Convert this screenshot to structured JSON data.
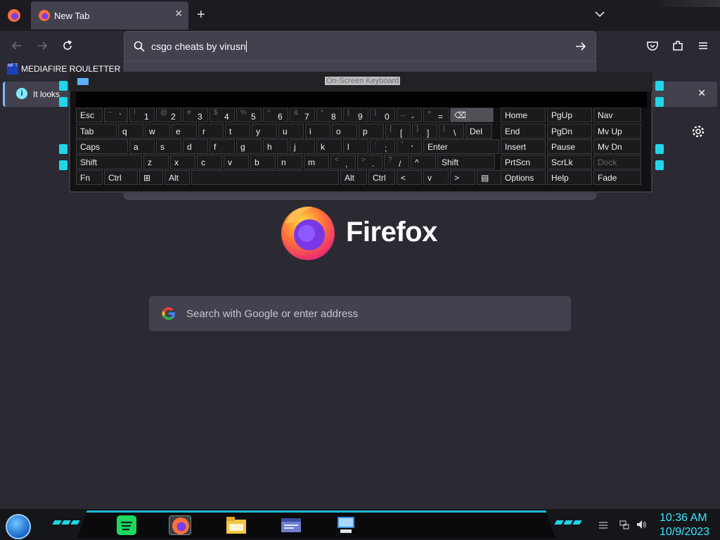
{
  "browser": {
    "tab": {
      "title": "New Tab",
      "close": "✕"
    },
    "new_tab": "+",
    "urlbar": {
      "value": "csgo cheats by virusn"
    },
    "bookmark": {
      "label": "MEDIAFIRE ROULETTER",
      "icon_text": "MF T"
    },
    "infobar": {
      "icon": "i",
      "text": "It looks",
      "close": "✕"
    }
  },
  "newtab": {
    "wordmark": "Firefox",
    "search_placeholder": "Search with Google or enter address"
  },
  "osk": {
    "title": "On-Screen Keyboard",
    "rows": [
      [
        {
          "main": "Esc"
        },
        {
          "shift": "~",
          "main": "`"
        },
        {
          "shift": "!",
          "main": "1"
        },
        {
          "shift": "@",
          "main": "2"
        },
        {
          "shift": "#",
          "main": "3"
        },
        {
          "shift": "$",
          "main": "4"
        },
        {
          "shift": "%",
          "main": "5"
        },
        {
          "shift": "^",
          "main": "6"
        },
        {
          "shift": "&",
          "main": "7"
        },
        {
          "shift": "*",
          "main": "8"
        },
        {
          "shift": "(",
          "main": "9"
        },
        {
          "shift": ")",
          "main": "0"
        },
        {
          "shift": "_",
          "main": "-"
        },
        {
          "shift": "+",
          "main": "="
        },
        {
          "main": "⌫"
        },
        {
          "main": "Home"
        },
        {
          "main": "PgUp"
        },
        {
          "main": "Nav"
        }
      ],
      [
        {
          "main": "Tab"
        },
        {
          "main": "q"
        },
        {
          "main": "w"
        },
        {
          "main": "e"
        },
        {
          "main": "r"
        },
        {
          "main": "t"
        },
        {
          "main": "y"
        },
        {
          "main": "u"
        },
        {
          "main": "i"
        },
        {
          "main": "o"
        },
        {
          "main": "p"
        },
        {
          "shift": "{",
          "main": "["
        },
        {
          "shift": "}",
          "main": "]"
        },
        {
          "shift": "|",
          "main": "\\"
        },
        {
          "main": "Del"
        },
        {
          "main": "End"
        },
        {
          "main": "PgDn"
        },
        {
          "main": "Mv Up"
        }
      ],
      [
        {
          "main": "Caps"
        },
        {
          "main": "a"
        },
        {
          "main": "s"
        },
        {
          "main": "d"
        },
        {
          "main": "f"
        },
        {
          "main": "g"
        },
        {
          "main": "h"
        },
        {
          "main": "j"
        },
        {
          "main": "k"
        },
        {
          "main": "l"
        },
        {
          "shift": ":",
          "main": ";"
        },
        {
          "shift": "\"",
          "main": "'"
        },
        {
          "main": "Enter"
        },
        {
          "main": "Insert"
        },
        {
          "main": "Pause"
        },
        {
          "main": "Mv Dn"
        }
      ],
      [
        {
          "main": "Shift"
        },
        {
          "main": "z"
        },
        {
          "main": "x"
        },
        {
          "main": "c"
        },
        {
          "main": "v"
        },
        {
          "main": "b"
        },
        {
          "main": "n"
        },
        {
          "main": "m"
        },
        {
          "shift": "<",
          "main": ","
        },
        {
          "shift": ">",
          "main": "."
        },
        {
          "shift": "?",
          "main": "/"
        },
        {
          "main": "^"
        },
        {
          "main": "Shift"
        },
        {
          "main": "PrtScn"
        },
        {
          "main": "ScrLk"
        },
        {
          "main": "Dock"
        }
      ],
      [
        {
          "main": "Fn"
        },
        {
          "main": "Ctrl"
        },
        {
          "main": "⊞"
        },
        {
          "main": "Alt"
        },
        {
          "main": ""
        },
        {
          "main": "Alt"
        },
        {
          "main": "Ctrl"
        },
        {
          "main": "<"
        },
        {
          "main": "v"
        },
        {
          "main": ">"
        },
        {
          "main": "▤"
        },
        {
          "main": "Options"
        },
        {
          "main": "Help"
        },
        {
          "main": "Fade"
        }
      ]
    ]
  },
  "taskbar": {
    "apps": [
      "spotify-icon",
      "firefox-icon",
      "file-explorer-icon",
      "window-app-icon",
      "remote-desktop-icon"
    ],
    "clock": {
      "time": "10:36 AM",
      "date": "10/9/2023"
    }
  }
}
